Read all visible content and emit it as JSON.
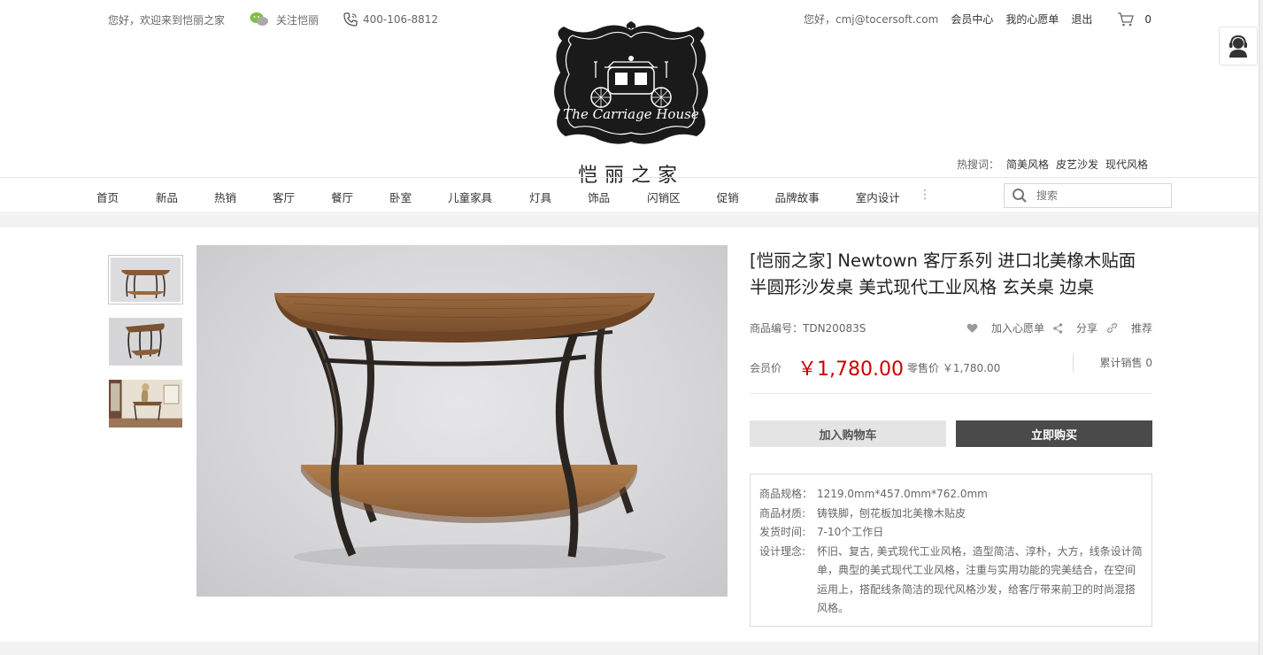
{
  "topbar": {
    "welcome": "您好，欢迎来到恺丽之家",
    "follow": "关注恺丽",
    "phone": "400-106-8812",
    "greeting": "您好，cmj@tocersoft.com",
    "member_center": "会员中心",
    "wishlist": "我的心愿单",
    "logout": "退出",
    "cart_count": "0"
  },
  "logo": {
    "script_text": "The Carriage House",
    "brand": "恺丽之家"
  },
  "hot_search": {
    "label": "热搜词：",
    "terms": [
      "简美风格",
      "皮艺沙发",
      "现代风格"
    ]
  },
  "nav": {
    "items": [
      "首页",
      "新品",
      "热销",
      "客厅",
      "餐厅",
      "卧室",
      "儿童家具",
      "灯具",
      "饰品",
      "闪销区",
      "促销",
      "品牌故事",
      "室内设计"
    ],
    "more": "⋮",
    "search_placeholder": "搜索"
  },
  "product": {
    "title": "[恺丽之家] Newtown 客厅系列 进口北美橡木贴面半圆形沙发桌 美式现代工业风格 玄关桌 边桌",
    "sku": "商品编号：TDN20083S",
    "add_wishlist": "加入心愿单",
    "share": "分享",
    "recommend": "推荐",
    "member_price_label": "会员价",
    "member_price": "￥1,780.00",
    "retail_price": "零售价 ￥1,780.00",
    "sold": "累计销售 0",
    "add_to_cart": "加入购物车",
    "buy_now": "立即购买",
    "specs": [
      {
        "k": "商品规格：",
        "v": "1219.0mm*457.0mm*762.0mm"
      },
      {
        "k": "商品材质:",
        "v": "铸铁脚，刨花板加北美橡木贴皮"
      },
      {
        "k": "发货时间:",
        "v": "7-10个工作日"
      },
      {
        "k": "设计理念:",
        "v": "怀旧、复古, 美式现代工业风格，造型简洁、淳朴，大方，线条设计简单，典型的美式现代工业风格，注重与实用功能的完美结合，在空间运用上，搭配线条简洁的现代风格沙发，给客厅带来前卫的时尚混搭风格。"
      }
    ]
  },
  "colors": {
    "price_red": "#cc0000",
    "buy_button": "#4a4a4a",
    "cart_button": "#e4e4e4"
  }
}
